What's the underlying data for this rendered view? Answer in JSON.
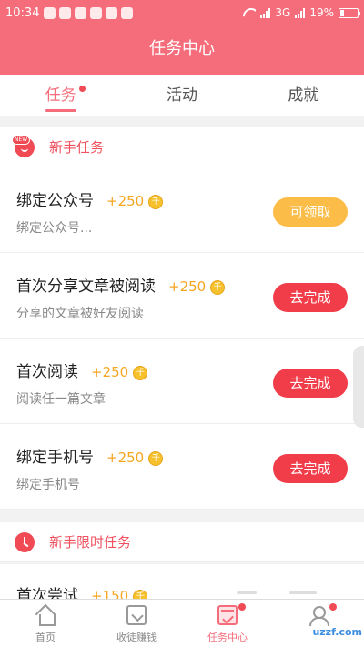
{
  "status_bar": {
    "time": "10:34",
    "network": "3G",
    "battery": "19%"
  },
  "header": {
    "title": "任务中心"
  },
  "tabs": [
    {
      "label": "任务",
      "active": true,
      "has_dot": true
    },
    {
      "label": "活动",
      "active": false
    },
    {
      "label": "成就",
      "active": false
    }
  ],
  "sections": [
    {
      "icon": "new-badge-icon",
      "title": "新手任务",
      "tasks": [
        {
          "name": "绑定公众号",
          "reward": "+250",
          "desc": "绑定公众号...",
          "button": "可领取",
          "button_state": "claim"
        },
        {
          "name": "首次分享文章被阅读",
          "reward": "+250",
          "desc": "分享的文章被好友阅读",
          "button": "去完成",
          "button_state": "todo"
        },
        {
          "name": "首次阅读",
          "reward": "+250",
          "desc": "阅读任一篇文章",
          "button": "去完成",
          "button_state": "todo"
        },
        {
          "name": "绑定手机号",
          "reward": "+250",
          "desc": "绑定手机号",
          "button": "去完成",
          "button_state": "todo"
        }
      ]
    },
    {
      "icon": "clock-icon",
      "title": "新手限时任务",
      "tasks": [
        {
          "name": "首次尝试",
          "reward": "+150"
        }
      ]
    }
  ],
  "coin_symbol": "千",
  "bottom_nav": [
    {
      "label": "首页",
      "icon": "home-icon",
      "active": false
    },
    {
      "label": "收徒赚钱",
      "icon": "envelope-icon",
      "active": false
    },
    {
      "label": "任务中心",
      "icon": "calendar-icon",
      "active": true,
      "badge": true
    },
    {
      "label": "",
      "icon": "user-icon",
      "active": false,
      "badge": true
    }
  ],
  "watermark": "uzzf.com",
  "colors": {
    "brand": "#f56d7b",
    "claim_button": "#fbbd47",
    "todo_button": "#f13c49",
    "reward": "#f5a623"
  }
}
